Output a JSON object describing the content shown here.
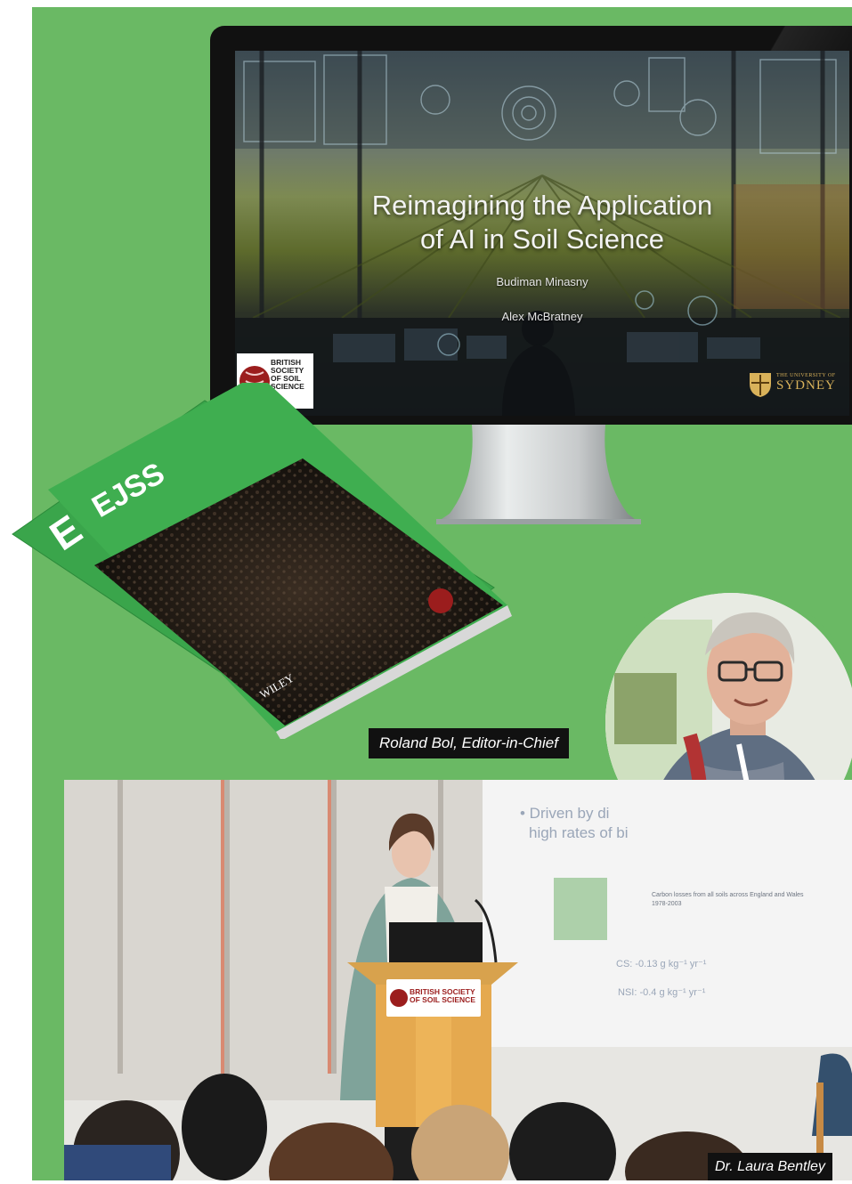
{
  "colors": {
    "panel_green": "#6ab964",
    "caption_bg": "#111111",
    "caption_text": "#ffffff",
    "brand_red": "#9b1d1d",
    "usyd_gold": "#d9b25a"
  },
  "slide": {
    "title_line1": "Reimagining the Application",
    "title_line2": "of AI in Soil Science",
    "author1": "Budiman Minasny",
    "author2": "Alex McBratney",
    "logo_left": {
      "line1": "BRITISH",
      "line2": "SOCIETY",
      "line3": "OF SOIL",
      "line4": "SCIENCE"
    },
    "logo_right": {
      "small": "THE UNIVERSITY OF",
      "big": "SYDNEY"
    }
  },
  "magazine": {
    "masthead": "EJSS",
    "publisher": "WILEY"
  },
  "captions": {
    "portrait": "Roland Bol, Editor-in-Chief",
    "speaker": "Dr. Laura Bentley"
  },
  "projection": {
    "bullet_line1": "• Driven by di",
    "bullet_line2": "high rates of bi",
    "figure_title": "Carbon losses from all soils across England and Wales",
    "figure_years": "1978-2003",
    "cs_rate": "CS: -0.13 g kg⁻¹ yr⁻¹",
    "nsi_rate": "NSI: -0.4 g kg⁻¹ yr⁻¹"
  },
  "podium_logo": {
    "line1": "BRITISH SOCIETY",
    "line2": "OF SOIL SCIENCE"
  }
}
